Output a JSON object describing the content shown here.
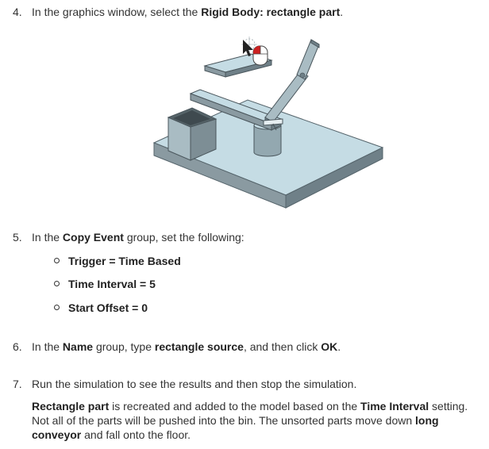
{
  "steps": [
    {
      "num": "4.",
      "t1": "In the graphics window, select the ",
      "b1": "Rigid Body: rectangle part",
      "t2": "."
    },
    {
      "num": "5.",
      "t1": "In the ",
      "b1": "Copy Event",
      "t2": " group, set the following:"
    },
    {
      "num": "6.",
      "t1": "In the ",
      "b1": "Name",
      "t2": " group, type ",
      "b2": "rectangle source",
      "t3": ", and then click ",
      "b3": "OK",
      "t4": "."
    },
    {
      "num": "7.",
      "t1": "Run the simulation to see the results and then stop the simulation."
    }
  ],
  "settings": [
    {
      "text": "Trigger = Time Based"
    },
    {
      "text": "Time Interval = 5"
    },
    {
      "text": "Start Offset = 0"
    }
  ],
  "result": {
    "b1": "Rectangle part",
    "t1": " is recreated and added to the model based on the ",
    "b2": "Time Interval",
    "t2": " setting.",
    "t3": "Not all of the parts will be pushed into the bin. The unsorted parts move down ",
    "b3": "long",
    "b4": "conveyor",
    "t4": " and fall onto the floor."
  },
  "colors": {
    "face_light": "#c5dce4",
    "face_side": "#6f8088",
    "face_mid": "#9fb5bd"
  },
  "figure_icon": "mouse-click-icon"
}
